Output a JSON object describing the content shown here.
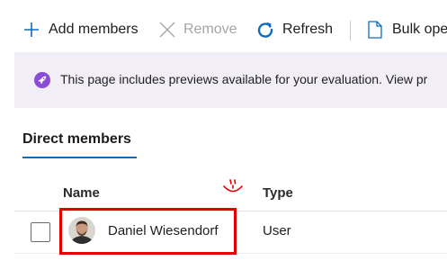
{
  "toolbar": {
    "add_members": "Add members",
    "remove": "Remove",
    "refresh": "Refresh",
    "bulk_operations": "Bulk ope"
  },
  "banner": {
    "text": "This page includes previews available for your evaluation. View pr",
    "icon": "rocket-icon"
  },
  "tabs": [
    {
      "label": "Direct members",
      "selected": true
    }
  ],
  "table": {
    "columns": [
      "Name",
      "Type"
    ],
    "rows": [
      {
        "name": "Daniel Wiesendorf",
        "type": "User"
      }
    ]
  },
  "colors": {
    "accent": "#0f6cbd",
    "banner_bg": "#f1eef8",
    "banner_icon": "#8a4bd6",
    "highlight": "#e30000"
  }
}
